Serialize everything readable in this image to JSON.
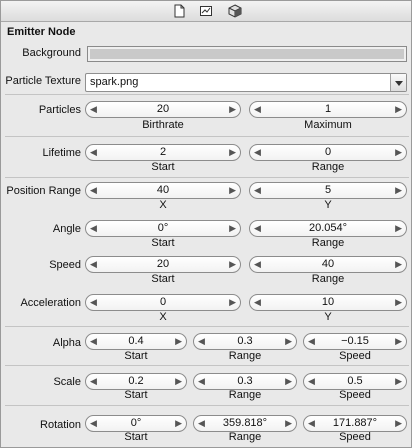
{
  "header": {
    "icons": [
      "file-icon",
      "image-icon",
      "cube-icon"
    ]
  },
  "section_title": "Emitter Node",
  "background": {
    "label": "Background",
    "color": "#c9c9c9"
  },
  "texture": {
    "label": "Particle Texture",
    "value": "spark.png"
  },
  "rows": {
    "particles": {
      "label": "Particles",
      "f1": "20",
      "c1": "Birthrate",
      "f2": "1",
      "c2": "Maximum"
    },
    "lifetime": {
      "label": "Lifetime",
      "f1": "2",
      "c1": "Start",
      "f2": "0",
      "c2": "Range"
    },
    "position": {
      "label": "Position Range",
      "f1": "40",
      "c1": "X",
      "f2": "5",
      "c2": "Y"
    },
    "angle": {
      "label": "Angle",
      "f1": "0°",
      "c1": "Start",
      "f2": "20.054°",
      "c2": "Range"
    },
    "speed": {
      "label": "Speed",
      "f1": "20",
      "c1": "Start",
      "f2": "40",
      "c2": "Range"
    },
    "acceleration": {
      "label": "Acceleration",
      "f1": "0",
      "c1": "X",
      "f2": "10",
      "c2": "Y"
    },
    "alpha": {
      "label": "Alpha",
      "f1": "0.4",
      "c1": "Start",
      "f2": "0.3",
      "c2": "Range",
      "f3": "−0.15",
      "c3": "Speed"
    },
    "scale": {
      "label": "Scale",
      "f1": "0.2",
      "c1": "Start",
      "f2": "0.3",
      "c2": "Range",
      "f3": "0.5",
      "c3": "Speed"
    },
    "rotation": {
      "label": "Rotation",
      "f1": "0°",
      "c1": "Start",
      "f2": "359.818°",
      "c2": "Range",
      "f3": "171.887°",
      "c3": "Speed"
    }
  }
}
